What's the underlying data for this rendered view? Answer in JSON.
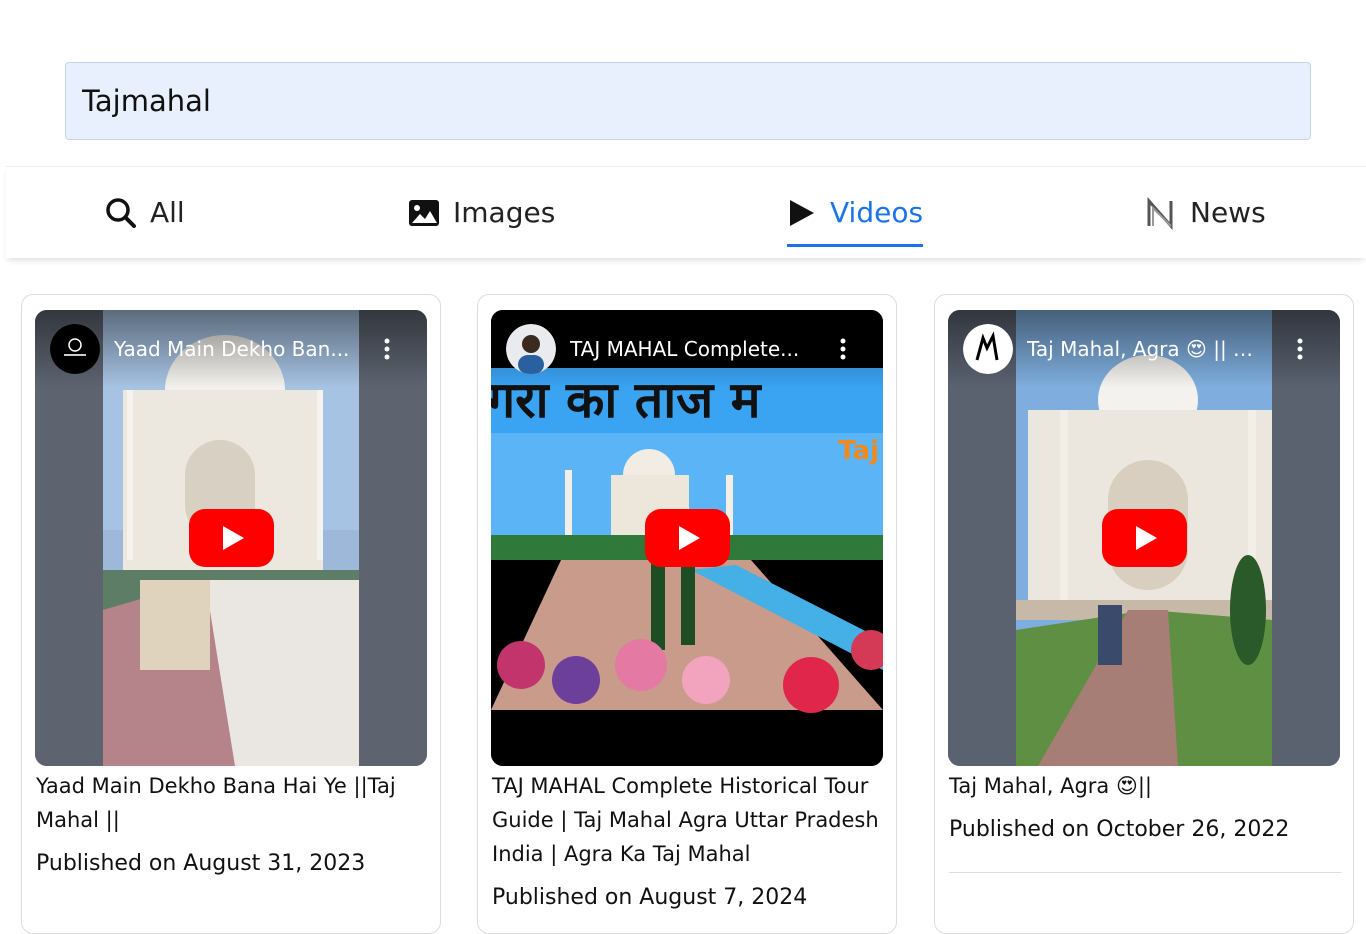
{
  "search": {
    "value": "Tajmahal"
  },
  "tabs": [
    {
      "label": "All",
      "icon": "search-icon"
    },
    {
      "label": "Images",
      "icon": "image-icon"
    },
    {
      "label": "Videos",
      "icon": "play-icon",
      "active": true
    },
    {
      "label": "News",
      "icon": "news-icon"
    }
  ],
  "accent": "#1a73e8",
  "videos": [
    {
      "overlay_title": "Yaad Main Dekho Ban...",
      "title": "Yaad Main Dekho Bana Hai Ye ||Taj Mahal ||",
      "published": "Published on August 31, 2023"
    },
    {
      "overlay_title": "TAJ MAHAL Complete...",
      "title": "TAJ MAHAL Complete Historical Tour Guide | Taj Mahal Agra Uttar Pradesh India | Agra Ka Taj Mahal",
      "published": "Published on August 7, 2024",
      "banner_text": "गरा का ताज म",
      "banner_tag": "Taj"
    },
    {
      "overlay_title": "Taj Mahal, Agra 😍 || #...",
      "title": "Taj Mahal, Agra 😍||",
      "published": "Published on October 26, 2022"
    }
  ]
}
